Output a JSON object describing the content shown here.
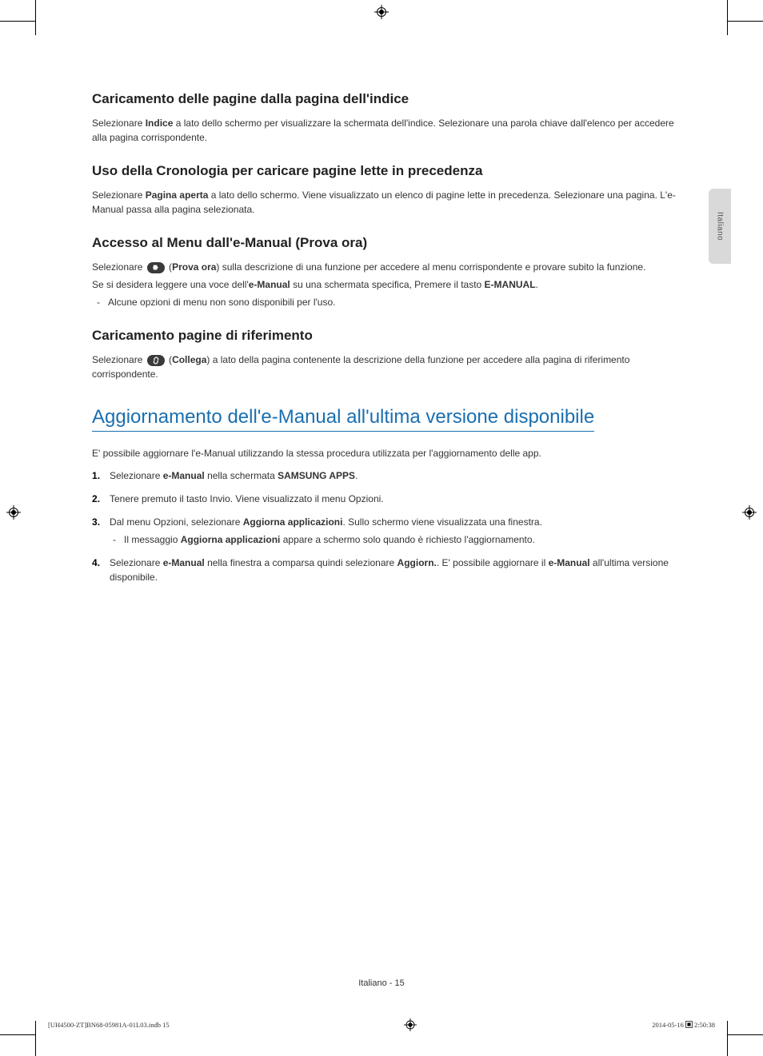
{
  "side_tab": "Italiano",
  "sections": {
    "s1": {
      "title": "Caricamento delle pagine dalla pagina dell'indice",
      "p1_a": "Selezionare ",
      "p1_bold": "Indice",
      "p1_b": " a lato dello schermo per visualizzare la schermata dell'indice. Selezionare una parola chiave dall'elenco per accedere alla pagina corrispondente."
    },
    "s2": {
      "title": "Uso della Cronologia per caricare pagine lette in precedenza",
      "p1_a": "Selezionare ",
      "p1_bold": "Pagina aperta",
      "p1_b": " a lato dello schermo. Viene visualizzato un elenco di pagine lette in precedenza. Selezionare una pagina. L'e-Manual passa alla pagina selezionata."
    },
    "s3": {
      "title": "Accesso al Menu dall'e-Manual (Prova ora)",
      "p1_a": "Selezionare ",
      "p1_boldA": "Prova ora",
      "p1_b": ") sulla descrizione di una funzione per accedere al menu corrispondente e provare subito la funzione.",
      "p2_a": "Se si desidera leggere una voce dell'",
      "p2_bold1": "e-Manual",
      "p2_b": " su una schermata specifica, Premere il tasto ",
      "p2_bold2": "E-MANUAL",
      "p2_c": ".",
      "dash": "Alcune opzioni di menu non sono disponibili per l'uso."
    },
    "s4": {
      "title": "Caricamento pagine di riferimento",
      "p1_a": "Selezionare ",
      "p1_boldA": "Collega",
      "p1_b": ") a lato della pagina contenente la descrizione della funzione per accedere alla pagina di riferimento corrispondente."
    },
    "main": {
      "heading": "Aggiornamento dell'e-Manual all'ultima versione disponibile",
      "intro": "E' possibile aggiornare l'e-Manual utilizzando la stessa procedura utilizzata per l'aggiornamento delle app.",
      "steps": {
        "1": {
          "a": "Selezionare ",
          "b1": "e-Manual",
          "b": " nella schermata ",
          "b2": "SAMSUNG APPS",
          "c": "."
        },
        "2": {
          "a": "Tenere premuto il tasto Invio. Viene visualizzato il menu Opzioni."
        },
        "3": {
          "a": "Dal menu Opzioni, selezionare ",
          "b1": "Aggiorna applicazioni",
          "b": ". Sullo schermo viene visualizzata una finestra.",
          "sub_a": "Il messaggio ",
          "sub_b1": "Aggiorna applicazioni",
          "sub_b": " appare a schermo solo quando è richiesto l'aggiornamento."
        },
        "4": {
          "a": "Selezionare ",
          "b1": "e-Manual",
          "b": " nella finestra a comparsa quindi selezionare ",
          "b2": "Aggiorn.",
          "c": ". E' possibile aggiornare il ",
          "b3": "e-Manual",
          "d": " all'ultima versione disponibile."
        }
      }
    }
  },
  "footer": {
    "page": "Italiano - 15",
    "file": "[UH4500-ZT]BN68-05981A-01L03.indb   15",
    "date": "2014-05-16   ",
    "time": "2:50:38"
  }
}
